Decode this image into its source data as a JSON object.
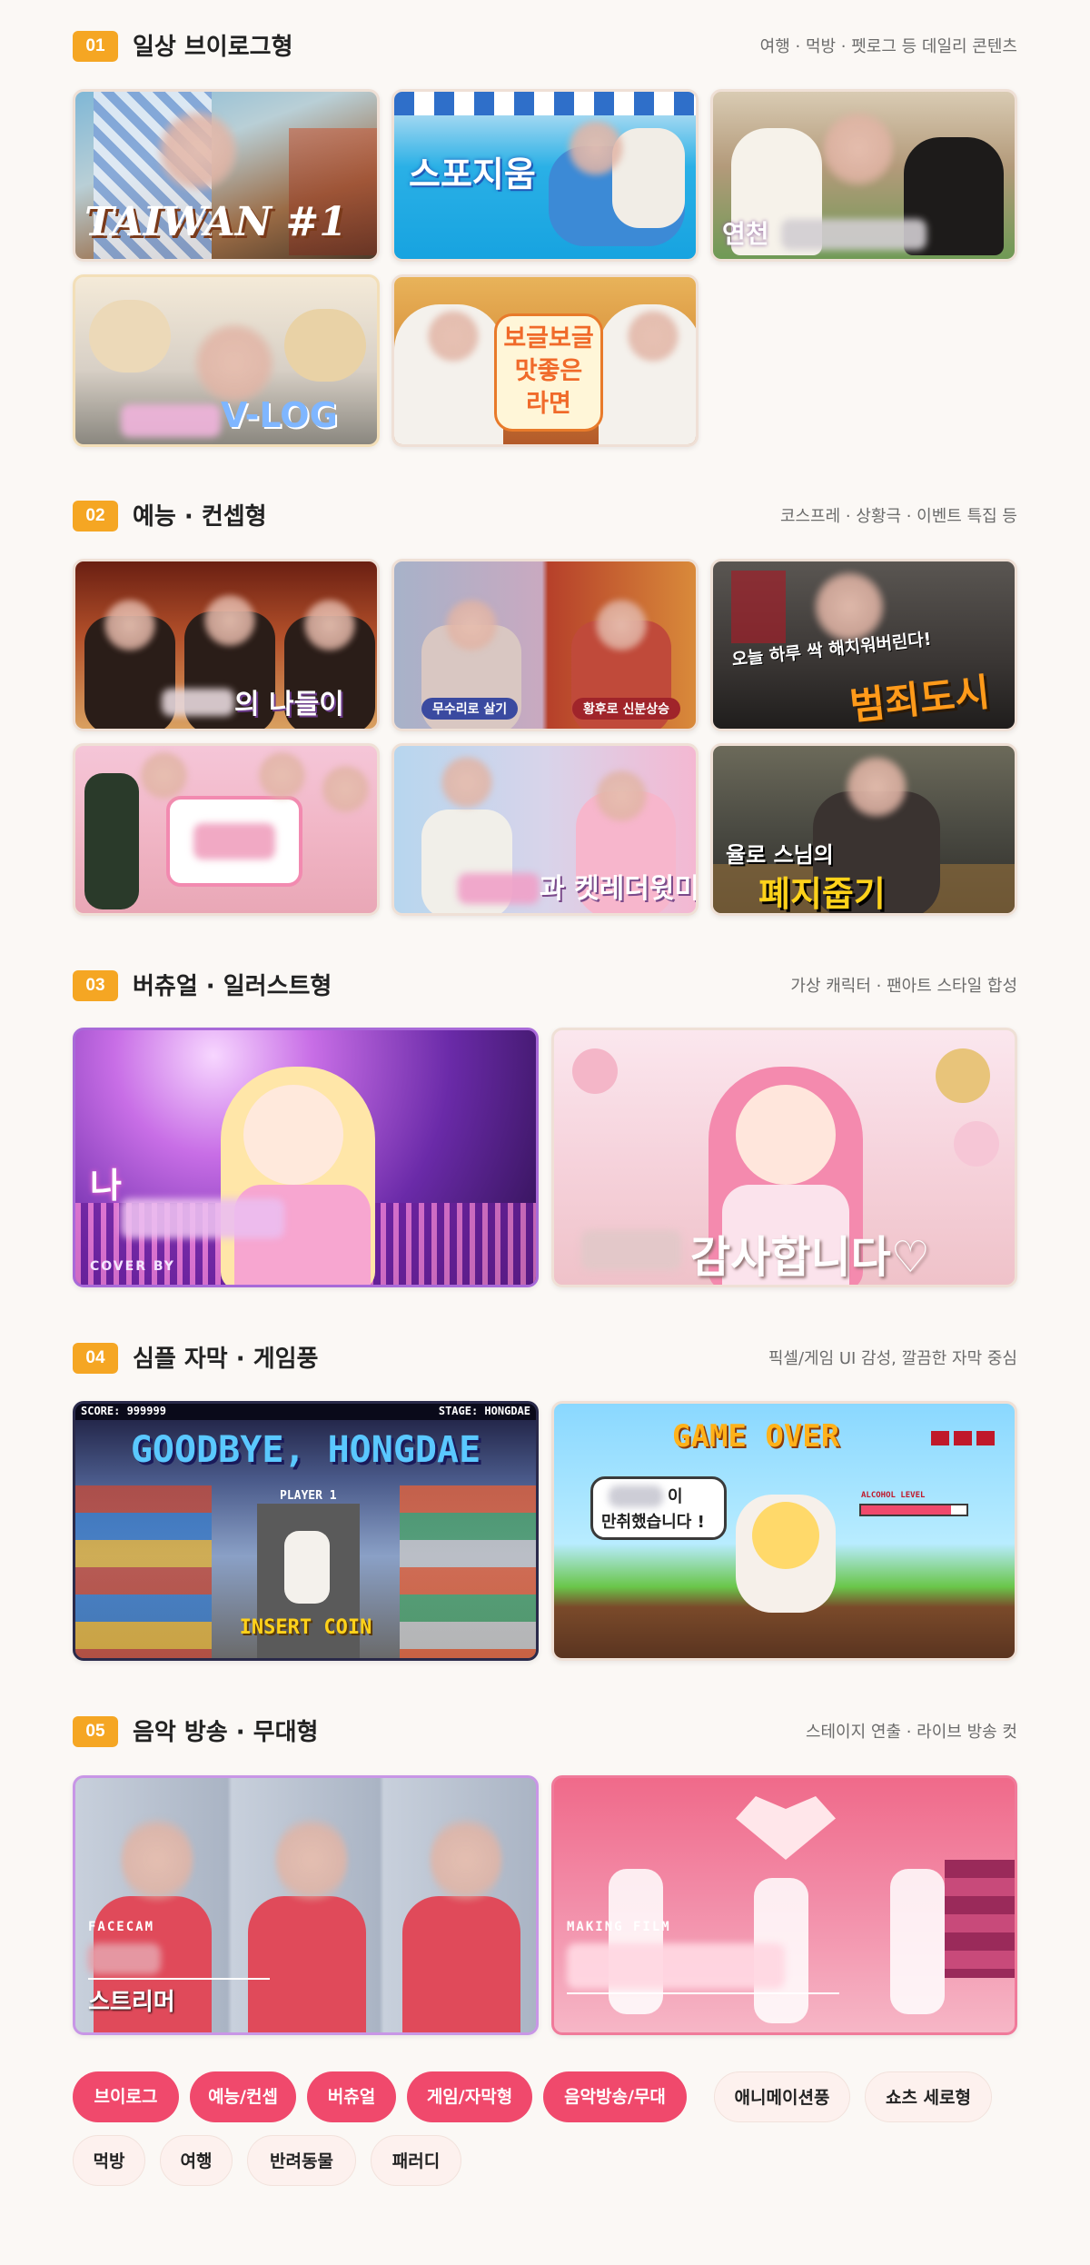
{
  "sections": [
    {
      "num": "01",
      "title": "일상 브이로그형",
      "desc": "여행 · 먹방 · 펫로그 등 데일리 콘텐츠",
      "cards": [
        {
          "caption": "TAIWAN #1"
        },
        {
          "caption": "스포지움"
        },
        {
          "caption": "연천"
        },
        {
          "caption": "V-LOG"
        },
        {
          "caption": "보글보글 맛좋은 라면"
        }
      ]
    },
    {
      "num": "02",
      "title": "예능 · 컨셉형",
      "desc": "코스프레 · 상황극 · 이벤트 특집 등",
      "cards": [
        {
          "caption": "의 나들이"
        },
        {
          "caption": "무수리로 살기",
          "caption2": "황후로 신분상승"
        },
        {
          "caption": "범죄도시",
          "sub": "오늘 하루 싹 해치워버린다!"
        },
        {
          "caption": ""
        },
        {
          "caption": "과 켓레더윗미"
        },
        {
          "caption": "폐지줍기",
          "sub": "율로 스님의"
        }
      ]
    },
    {
      "num": "03",
      "title": "버츄얼 · 일러스트형",
      "desc": "가상 캐릭터 · 팬아트 스타일 합성",
      "cards": [
        {
          "caption": "나",
          "sub": "COVER BY"
        },
        {
          "caption": "감사합니다♡"
        }
      ]
    },
    {
      "num": "04",
      "title": "심플 자막 · 게임풍",
      "desc": "픽셀/게임 UI 감성, 깔끔한 자막 중심",
      "cards": [
        {
          "caption": "GOODBYE, HONGDAE",
          "score": "SCORE: 999999",
          "stage": "STAGE: HONGDAE",
          "player": "PLAYER 1",
          "insert": "INSERT COIN"
        },
        {
          "caption": "GAME OVER",
          "bubble1": "이",
          "bubble2": "만취했습니다 !",
          "gauge": "ALCOHOL LEVEL"
        }
      ]
    },
    {
      "num": "05",
      "title": "음악 방송 · 무대형",
      "desc": "스테이지 연출 · 라이브 방송 컷",
      "cards": [
        {
          "caption": "스트리머",
          "sub": "FACECAM"
        },
        {
          "caption": "",
          "sub": "MAKING FILM"
        }
      ]
    }
  ],
  "tags": [
    {
      "label": "브이로그",
      "active": true
    },
    {
      "label": "예능/컨셉",
      "active": true
    },
    {
      "label": "버츄얼",
      "active": true
    },
    {
      "label": "게임/자막형",
      "active": true
    },
    {
      "label": "음악방송/무대",
      "active": true
    },
    {
      "label": "애니메이션풍",
      "active": false
    },
    {
      "label": "쇼츠 세로형",
      "active": false
    },
    {
      "label": "먹방",
      "active": false
    },
    {
      "label": "여행",
      "active": false
    },
    {
      "label": "반려동물",
      "active": false
    },
    {
      "label": "패러디",
      "active": false
    }
  ],
  "colors": {
    "accent": "#f5a623",
    "tag_active": "#f0496c"
  }
}
